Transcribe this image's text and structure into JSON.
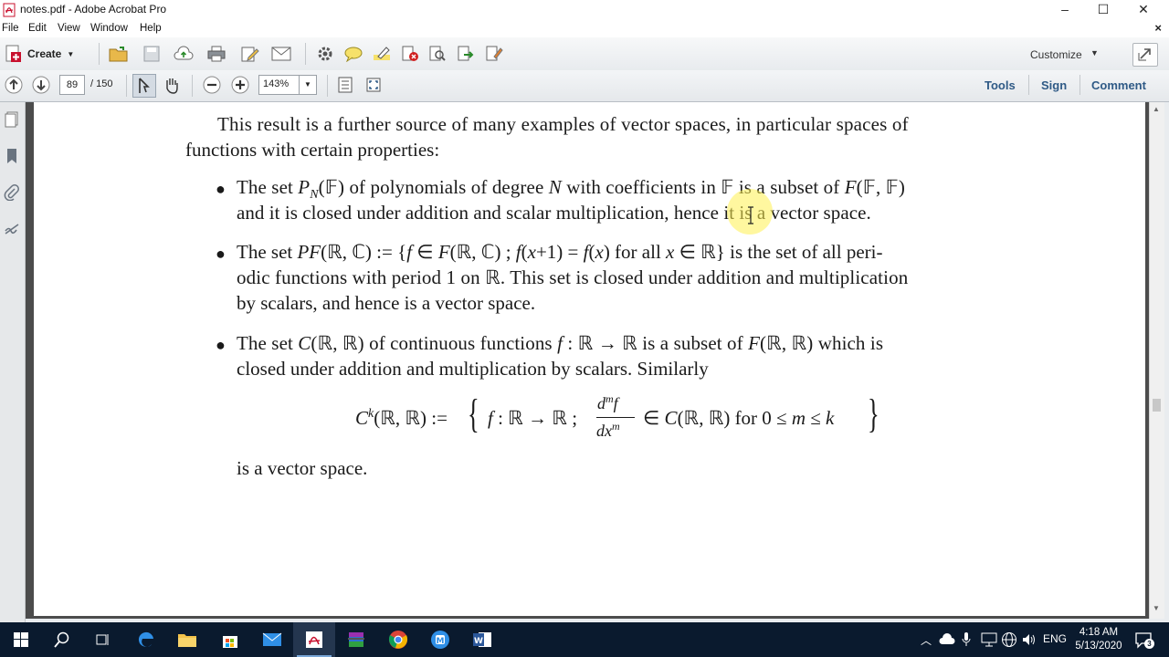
{
  "window": {
    "title": "notes.pdf - Adobe Acrobat Pro",
    "minimize": "–",
    "maximize": "☐",
    "close": "✕"
  },
  "menu": {
    "items": [
      "File",
      "Edit",
      "View",
      "Window",
      "Help"
    ],
    "close_doc": "×"
  },
  "toolbar": {
    "create_label": "Create",
    "customize_label": "Customize"
  },
  "nav": {
    "current_page": "89",
    "total_pages": "/ 150",
    "zoom": "143%",
    "tools_label": "Tools",
    "sign_label": "Sign",
    "comment_label": "Comment"
  },
  "document": {
    "intro_line1": "This result is a further source of many examples of vector spaces, in particular spaces of",
    "intro_line2": "functions with certain properties:",
    "b1_line2": "and it is closed under addition and scalar multiplication, hence it is a vector space.",
    "b2_line2": "odic functions with period 1 on ℝ. This set is closed under addition and multiplication",
    "b2_line3": "by scalars, and hence is a vector space.",
    "b3_line2": "closed under addition and multiplication by scalars. Similarly",
    "closing": "is a vector space."
  },
  "taskbar": {
    "language": "ENG",
    "time": "4:18 AM",
    "date": "5/13/2020",
    "notifications": "3"
  },
  "colors": {
    "panel_link": "#2f5a86",
    "taskbar_bg": "#0a1a2e",
    "pdf_icon": "#c8102e"
  }
}
